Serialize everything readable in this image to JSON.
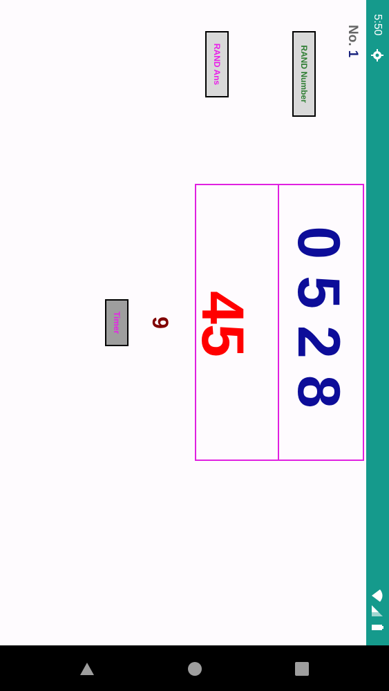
{
  "status_bar": {
    "time": "5:50",
    "icons": [
      "gear-icon",
      "wifi-signal-icon",
      "cell-signal-icon",
      "battery-icon"
    ],
    "color": "#159a8c"
  },
  "header": {
    "no_label": "No.",
    "no_value": "1"
  },
  "buttons": {
    "rand_number": "RAND Number",
    "rand_ans": "RAND Ans",
    "timer": "Timer"
  },
  "main": {
    "digits": "0528",
    "answer": "45",
    "timer_count": "9"
  },
  "colors": {
    "digits": "#0d0d99",
    "answer": "#ff0000",
    "timer_count": "#800000",
    "box_border": "#e020e0"
  },
  "nav_bar": {
    "icons": [
      "back-triangle-icon",
      "home-circle-icon",
      "recents-square-icon"
    ]
  }
}
